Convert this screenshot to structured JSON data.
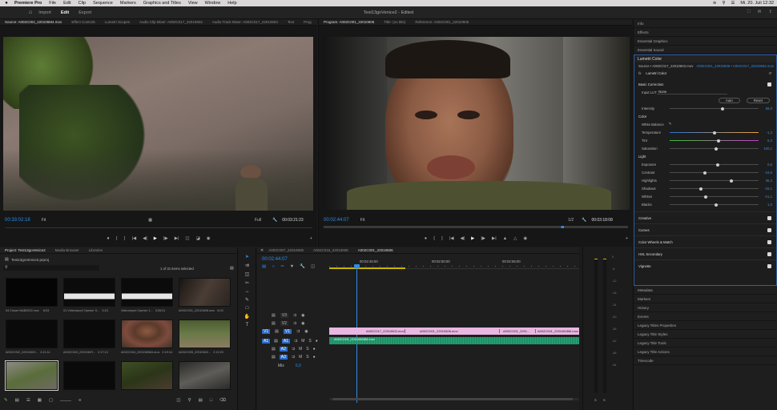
{
  "menubar": {
    "apple": "",
    "app_name": "Premiere Pro",
    "items": [
      "File",
      "Edit",
      "Clip",
      "Sequence",
      "Markers",
      "Graphics and Titles",
      "View",
      "Window",
      "Help"
    ],
    "clock": "Mi. 20. Juli 12:32"
  },
  "appbar": {
    "workspaces": [
      "Import",
      "Edit",
      "Export"
    ],
    "active_workspace": "Edit",
    "project_title": "Test13goVenice2 - Edited"
  },
  "source_monitor": {
    "tabs": [
      "Source: A002C004_220106M4.mov",
      "Effect Controls",
      "Lumetri Scopes",
      "Audio Clip Mixer: A002C017_22010602",
      "Audio Track Mixer: A002C017_22010604",
      "Text",
      "Prog"
    ],
    "timecode": "00:33:02:18",
    "fit": "Fit",
    "quality": "Full",
    "duration": "00:03:21:23"
  },
  "program_monitor": {
    "tabs": [
      "Program: A002C001_22010606",
      "Title: (no title)",
      "Reference: A002C001_22010606"
    ],
    "timecode": "00:02:44:07",
    "fit": "Fit",
    "quality": "1/2",
    "duration": "00:03:18:08"
  },
  "right_panel": {
    "top_items": [
      "Info",
      "Effects",
      "Essential Graphics",
      "Essential Sound"
    ],
    "lumetri": {
      "title": "Lumetri Color",
      "source": "Source • A002C017_22010602.mov",
      "sequence": "A002C001_22010606 • A002C017_22010602.mov",
      "fx_label": "fx",
      "effect": "Lumetri Color",
      "basic_correction": "Basic Correction",
      "input_lut_label": "Input LUT",
      "input_lut": "None",
      "auto": "Auto",
      "reset": "Reset",
      "intensity_label": "Intensity",
      "intensity": "58,0",
      "color_section": "Color",
      "white_balance": "White Balance",
      "temperature_label": "Temperature",
      "temperature": "-1,3",
      "tint_label": "Tint",
      "tint": "6,3",
      "saturation_label": "Saturation",
      "saturation": "100,1",
      "light_section": "Light",
      "exposure_label": "Exposure",
      "exposure": "0,6",
      "contrast_label": "Contrast",
      "contrast": "-23,6",
      "highlights_label": "Highlights",
      "highlights": "36,2",
      "shadows_label": "Shadows",
      "shadows": "-33,1",
      "whites_label": "Whites",
      "whites": "-21,1",
      "blacks_label": "Blacks",
      "blacks": "1,0",
      "sections": [
        "Creative",
        "Curves",
        "Color Wheels & Match",
        "HSL Secondary",
        "Vignette"
      ]
    },
    "bottom_items": [
      "Metadata",
      "Markers",
      "History",
      "Events",
      "Legacy Titles Properties",
      "Legacy Title Styles",
      "Legacy Title Tools",
      "Legacy Title Actions",
      "Timecode"
    ]
  },
  "project": {
    "tabs": [
      "Project: Test13goVenice2",
      "Media Browser",
      "Libraries"
    ],
    "file": "Test13goVenice2.prproj",
    "count": "1 of 31 items selected",
    "items": [
      {
        "name": "04 Closer NAB2022.mov",
        "dur": "8:03"
      },
      {
        "name": "01 Videoreport Opener S...",
        "dur": "3:15"
      },
      {
        "name": "Videoreport Opener 1...",
        "dur": "3:26:01"
      },
      {
        "name": "A002C001_22010606.mov",
        "dur": "6:03"
      },
      {
        "name": "A002C002_2201062V...",
        "dur": "2:21:11"
      },
      {
        "name": "A002C003_2201060Y...",
        "dur": "2:17:13"
      },
      {
        "name": "A002C004_2201060M4.mov",
        "dur": "2:19:14"
      },
      {
        "name": "A002C005_22010602...",
        "dur": "2:12:20"
      }
    ]
  },
  "timeline": {
    "tabs": [
      "A002C007_22010606",
      "A002C016_22010606",
      "A002C001_22010606"
    ],
    "timecode": "00:02:44:07",
    "ruler": [
      "00:02:45:00",
      "00:02:50:00",
      "00:02:55:00"
    ],
    "video_tracks": [
      "V3",
      "V2",
      "V1"
    ],
    "audio_tracks": [
      "A1",
      "A2",
      "A3"
    ],
    "mix_label": "Mix",
    "mix_value": "0,0",
    "clips": [
      "A002C017_22010602.mov",
      "A002C001_22010606.mov",
      "A002C001_2201...",
      "A002C001_22010606M.mov"
    ],
    "audio_clip": "A002C001_22010606M.mov"
  },
  "meters": {
    "labels": [
      "S",
      "S"
    ],
    "ticks": [
      "0",
      "-6",
      "-12",
      "-18",
      "-24",
      "-30",
      "-36",
      "-42",
      "-48",
      "-54"
    ]
  },
  "colors": {
    "accent": "#2d8ceb",
    "video_clip": "#e9b7e2",
    "audio_clip": "#1f8f65",
    "selection": "#2e5fa8"
  }
}
